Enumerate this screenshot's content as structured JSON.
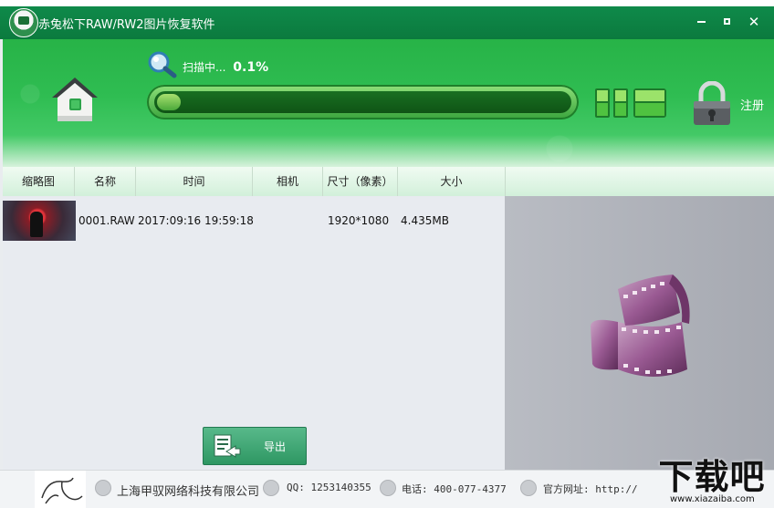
{
  "window": {
    "title": "赤兔松下RAW/RW2图片恢复软件",
    "controls": {
      "minimize": "",
      "maximize": "",
      "close": "✕"
    }
  },
  "header": {
    "scan_label": "扫描中...",
    "scan_percent": "0.1%",
    "progress_fraction": 0.012,
    "register_label": "注册"
  },
  "columns": [
    "缩略图",
    "名称",
    "时间",
    "相机",
    "尺寸（像素）",
    "大小"
  ],
  "files": [
    {
      "name": "0001.RAW",
      "time": "2017:09:16 19:59:18",
      "camera": "",
      "dimensions": "1920*1080",
      "size": "4.435MB"
    }
  ],
  "export_button": {
    "label": "导出"
  },
  "footer": {
    "company": "上海甲驭网络科技有限公司",
    "qq": "QQ: 1253140355",
    "phone": "电话: 400-077-4377",
    "website": "官方网址: http://"
  },
  "watermark": {
    "text": "下载吧",
    "url": "www.xiazaiba.com"
  },
  "colors": {
    "accent_green": "#2fbd52",
    "title_green": "#0f8a4a",
    "export_green": "#3a9f6c"
  },
  "icons": [
    "app-logo",
    "home-icon",
    "search-icon",
    "pause-icon",
    "lock-icon",
    "export-icon",
    "film-reel-icon",
    "building-icon",
    "qq-icon",
    "phone-icon",
    "globe-icon"
  ]
}
